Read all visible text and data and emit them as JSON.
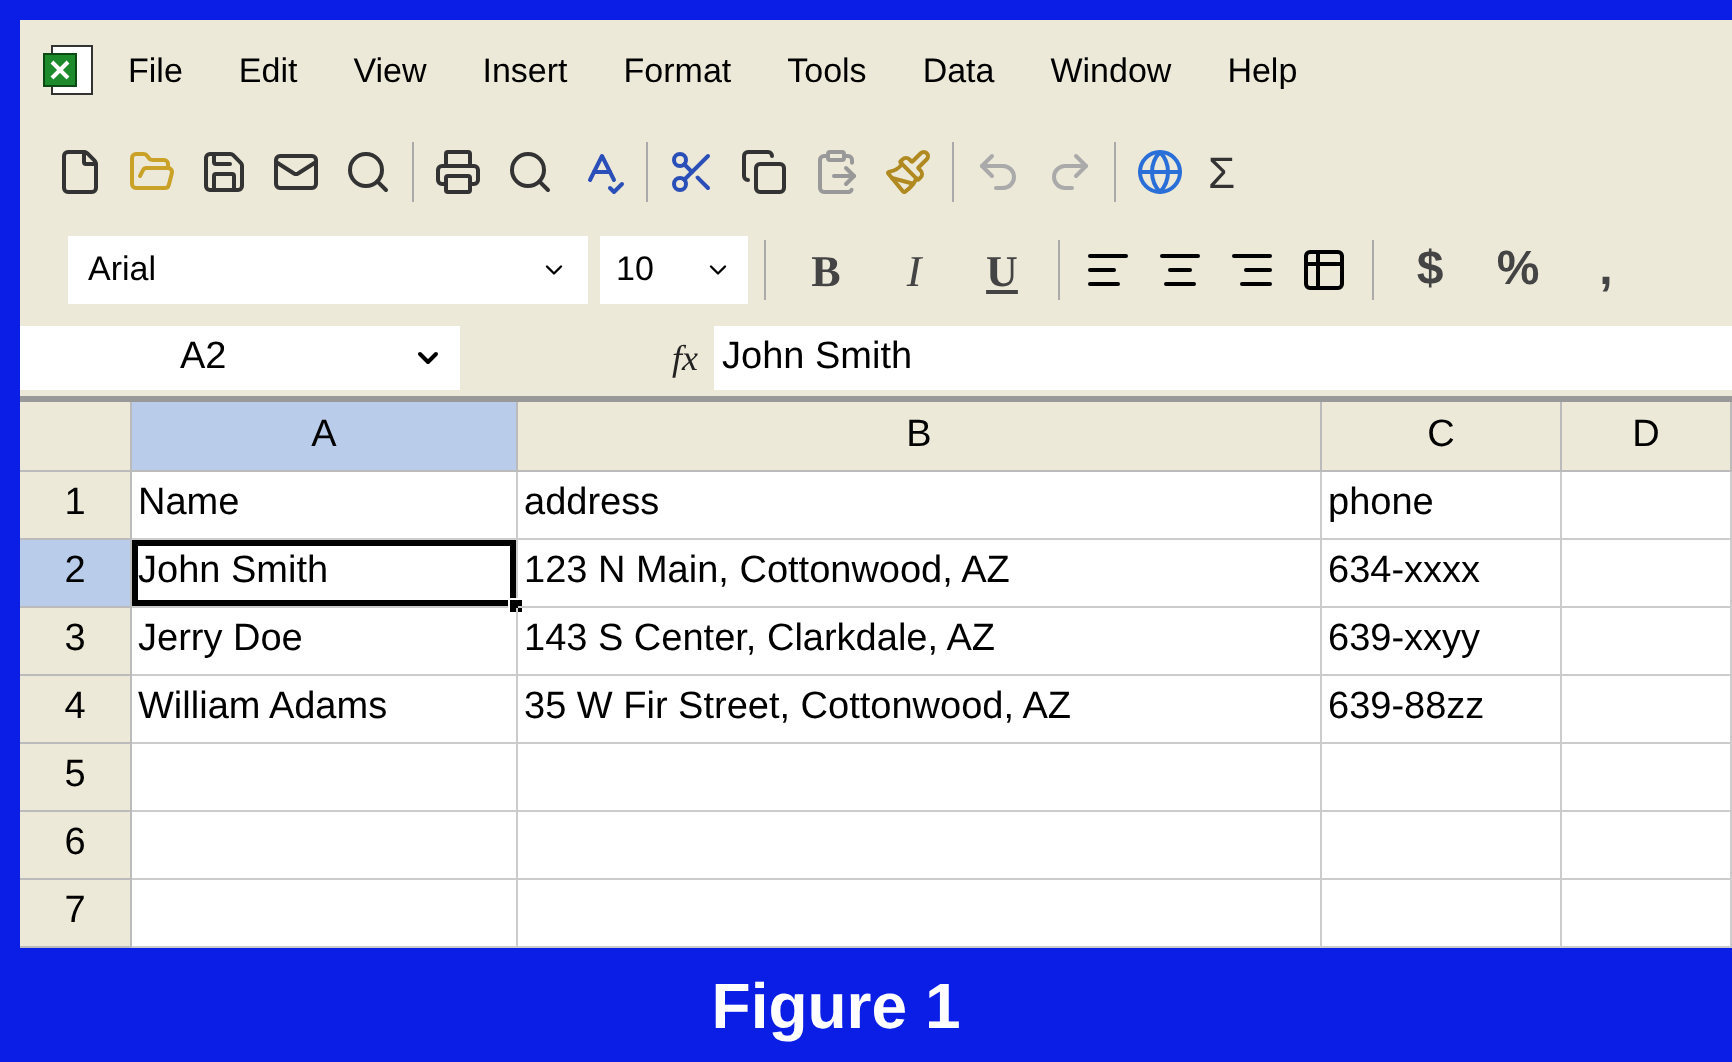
{
  "menu_bar": {
    "items": [
      "File",
      "Edit",
      "View",
      "Insert",
      "Format",
      "Tools",
      "Data",
      "Window",
      "Help"
    ]
  },
  "standard_toolbar": {
    "sum_symbol": "Σ"
  },
  "formatting_toolbar": {
    "font": "Arial",
    "size": "10",
    "style_buttons": [
      "B",
      "I",
      "U"
    ],
    "number_buttons": [
      "$",
      "%",
      ","
    ]
  },
  "formula_bar": {
    "name_box": "A2",
    "function_symbol": "fx",
    "value": "John Smith"
  },
  "sheet": {
    "columns": [
      {
        "label": "A",
        "selected": true
      },
      {
        "label": "B",
        "selected": false
      },
      {
        "label": "C",
        "selected": false
      },
      {
        "label": "D",
        "selected": false
      }
    ],
    "rows": [
      {
        "number": "1",
        "selected": false,
        "cells": [
          {
            "text": "Name",
            "active": false
          },
          {
            "text": "address",
            "active": false
          },
          {
            "text": "phone",
            "active": false
          }
        ]
      },
      {
        "number": "2",
        "selected": true,
        "cells": [
          {
            "text": "John Smith",
            "active": true
          },
          {
            "text": "123 N Main, Cottonwood, AZ",
            "active": false
          },
          {
            "text": "634-xxxx",
            "active": false
          }
        ]
      },
      {
        "number": "3",
        "selected": false,
        "cells": [
          {
            "text": "Jerry Doe",
            "active": false
          },
          {
            "text": "143 S Center, Clarkdale, AZ",
            "active": false
          },
          {
            "text": "639-xxyy",
            "active": false
          }
        ]
      },
      {
        "number": "4",
        "selected": false,
        "cells": [
          {
            "text": "William Adams",
            "active": false
          },
          {
            "text": "35 W Fir Street, Cottonwood, AZ",
            "active": false
          },
          {
            "text": "639-88zz",
            "active": false
          }
        ]
      },
      {
        "number": "5",
        "selected": false
      },
      {
        "number": "6",
        "selected": false
      },
      {
        "number": "7",
        "selected": false
      }
    ]
  },
  "caption": "Figure 1"
}
